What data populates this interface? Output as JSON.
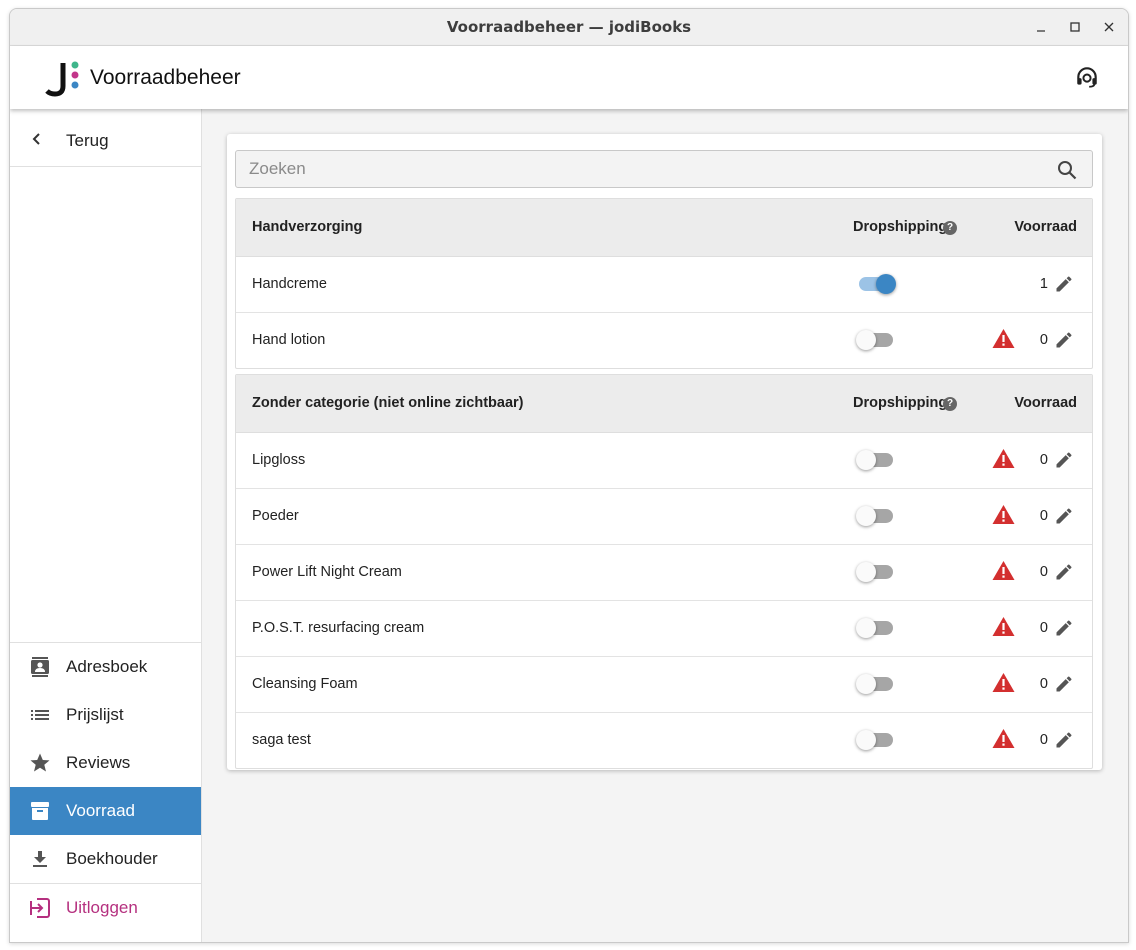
{
  "window": {
    "title": "Voorraadbeheer — jodiBooks"
  },
  "app": {
    "title": "Voorraadbeheer",
    "logo_letter": "J"
  },
  "sidebar": {
    "back_label": "Terug",
    "items": [
      {
        "label": "Adresboek",
        "icon": "contacts-icon"
      },
      {
        "label": "Prijslijst",
        "icon": "list-icon"
      },
      {
        "label": "Reviews",
        "icon": "star-icon"
      },
      {
        "label": "Voorraad",
        "icon": "archive-icon",
        "active": true
      },
      {
        "label": "Boekhouder",
        "icon": "download-icon"
      }
    ],
    "logout_label": "Uitloggen"
  },
  "search": {
    "placeholder": "Zoeken",
    "value": ""
  },
  "categories": [
    {
      "name": "Handverzorging",
      "col_dropshipping": "Dropshipping",
      "col_voorraad": "Voorraad",
      "products": [
        {
          "name": "Handcreme",
          "dropshipping": true,
          "warning": false,
          "stock": "1"
        },
        {
          "name": "Hand lotion",
          "dropshipping": false,
          "warning": true,
          "stock": "0"
        }
      ]
    },
    {
      "name": "Zonder categorie (niet online zichtbaar)",
      "col_dropshipping": "Dropshipping",
      "col_voorraad": "Voorraad",
      "products": [
        {
          "name": "Lipgloss",
          "dropshipping": false,
          "warning": true,
          "stock": "0"
        },
        {
          "name": "Poeder",
          "dropshipping": false,
          "warning": true,
          "stock": "0"
        },
        {
          "name": "Power Lift Night Cream",
          "dropshipping": false,
          "warning": true,
          "stock": "0"
        },
        {
          "name": "P.O.S.T. resurfacing cream",
          "dropshipping": false,
          "warning": true,
          "stock": "0"
        },
        {
          "name": "Cleansing Foam",
          "dropshipping": false,
          "warning": true,
          "stock": "0"
        },
        {
          "name": "saga test",
          "dropshipping": false,
          "warning": true,
          "stock": "0"
        }
      ]
    }
  ],
  "colors": {
    "accent": "#3b86c4",
    "warning": "#d32f2f",
    "logout": "#b5307f",
    "logo_green": "#3fb68b",
    "logo_magenta": "#c2368a",
    "logo_blue": "#3b86c4"
  }
}
